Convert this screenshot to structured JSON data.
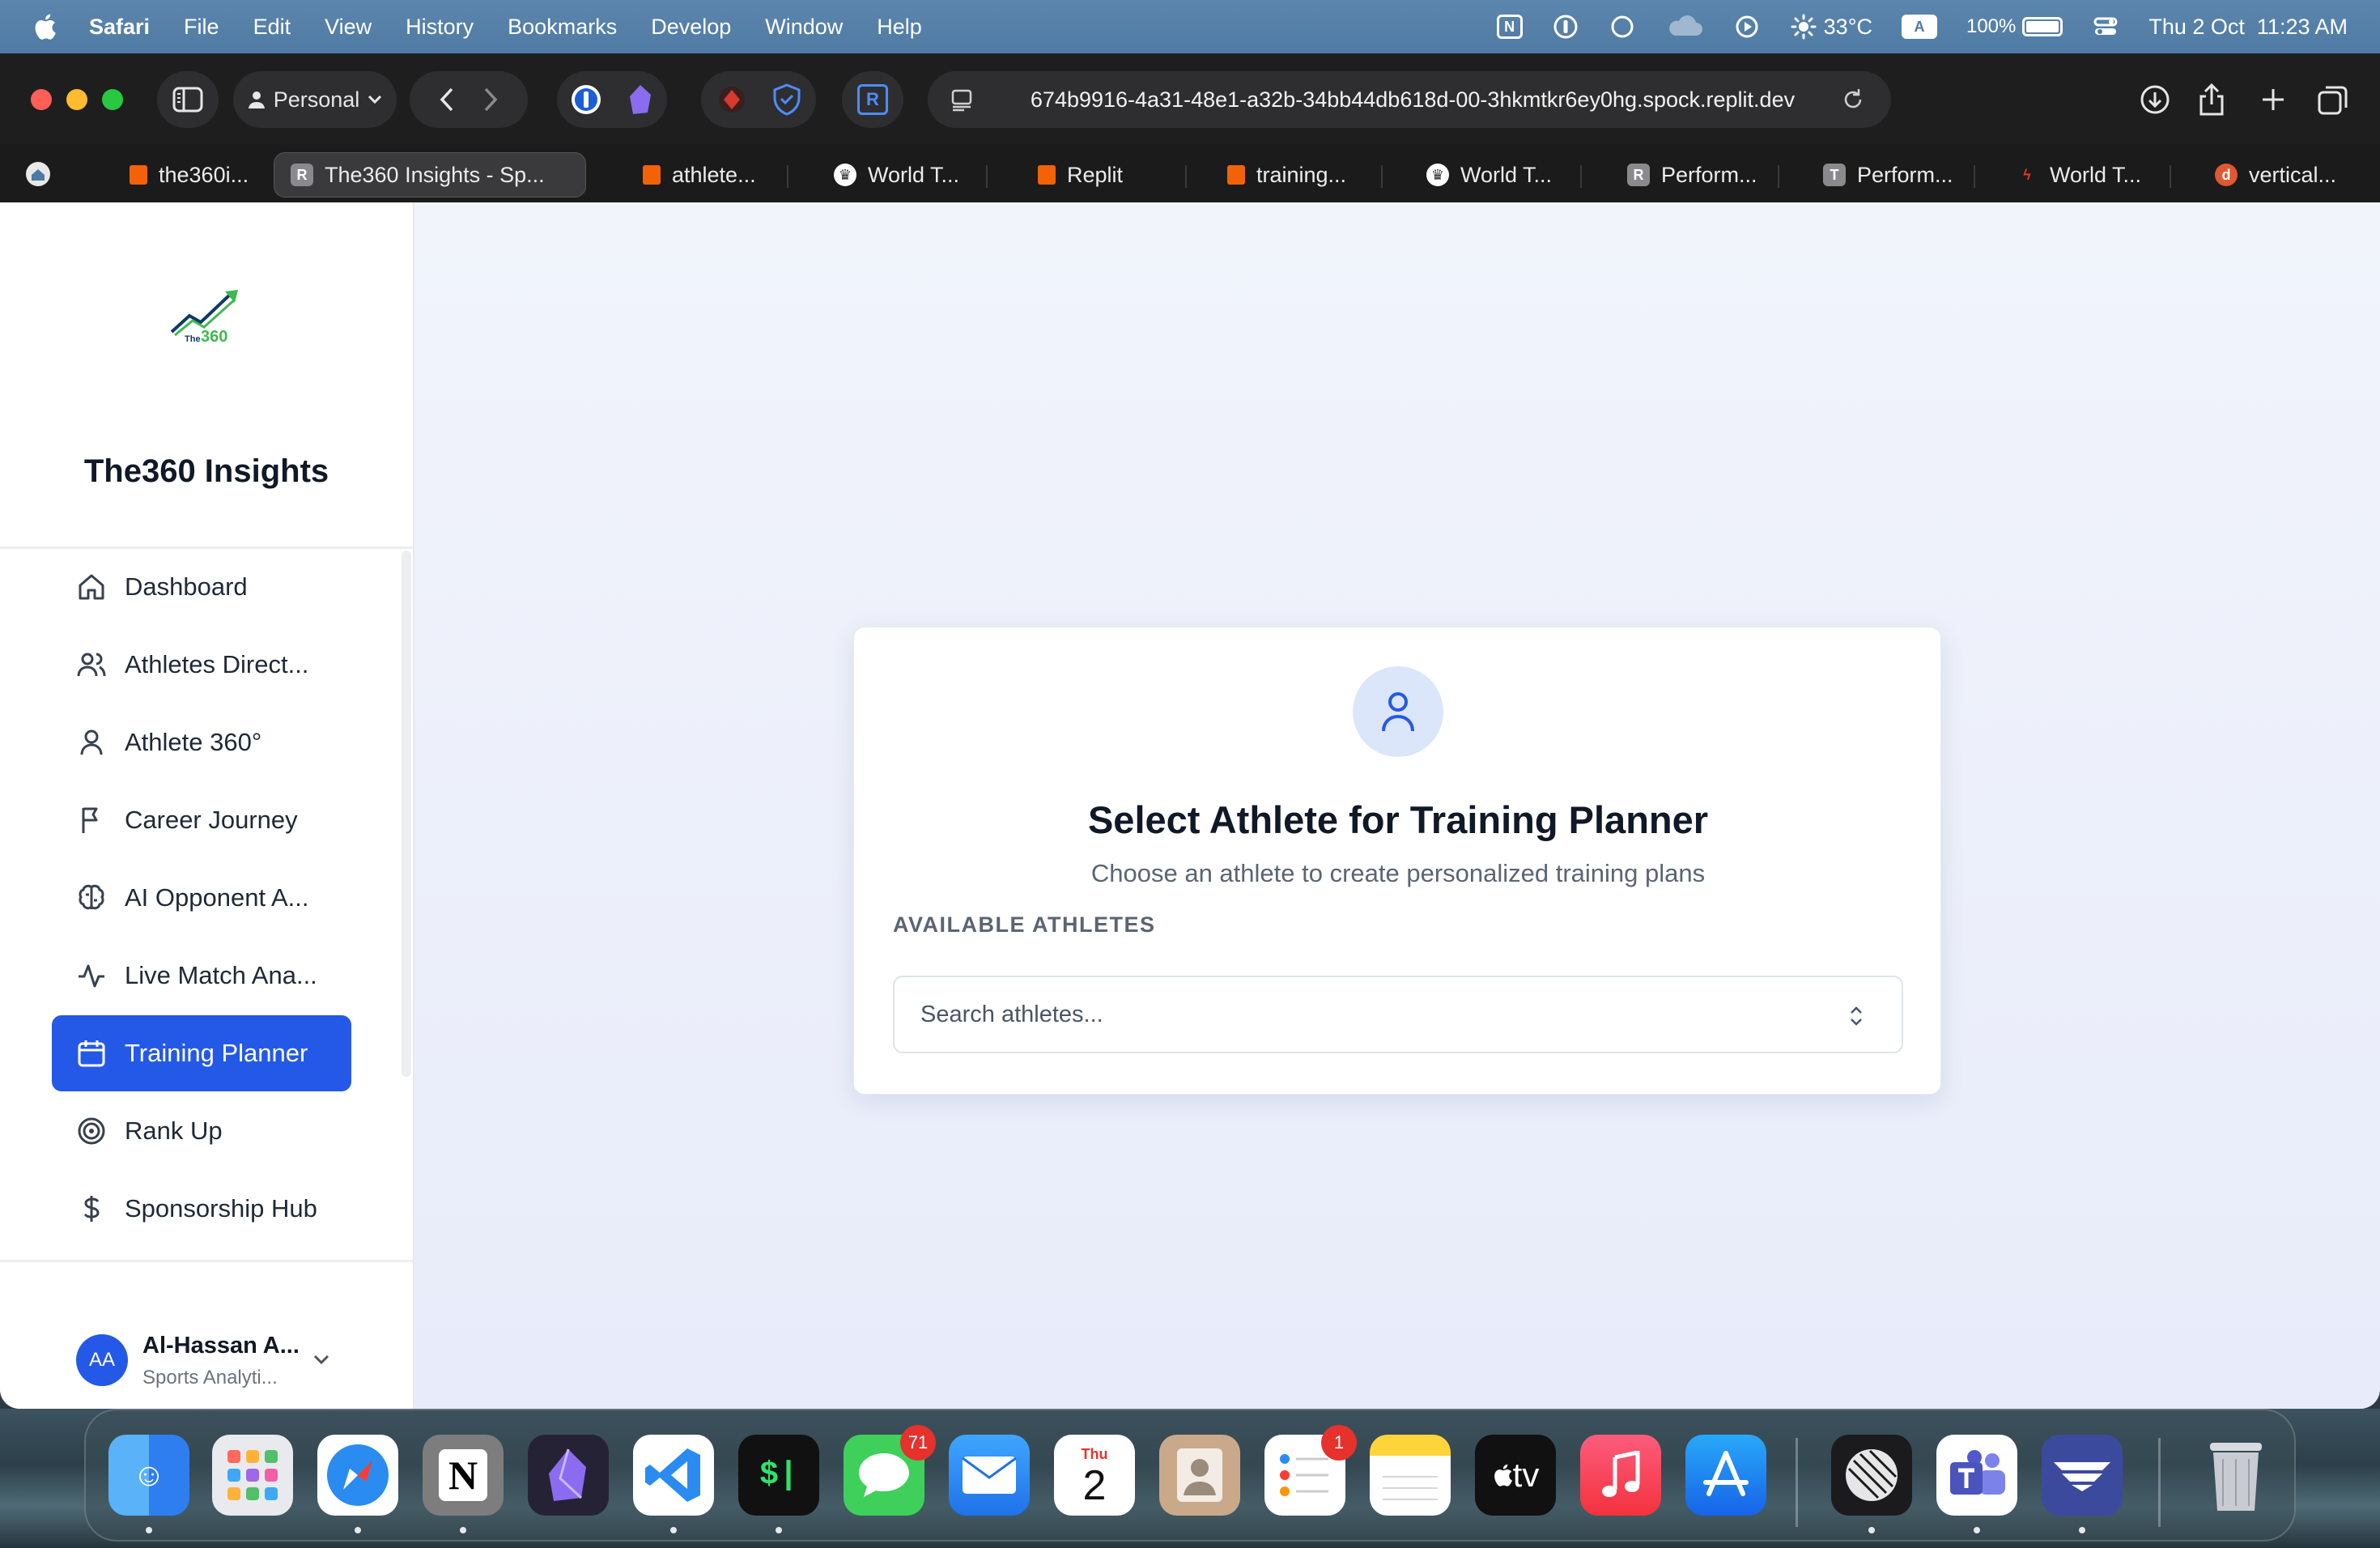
{
  "menubar": {
    "app": "Safari",
    "items": [
      "File",
      "Edit",
      "View",
      "History",
      "Bookmarks",
      "Develop",
      "Window",
      "Help"
    ],
    "weather": "33°C",
    "input_source": "A",
    "battery": "100%",
    "datetime": "Thu 2 Oct  11:23 AM"
  },
  "browser": {
    "profile": "Personal",
    "url": "674b9916-4a31-48e1-a32b-34bb44db618d-00-3hkmtkr6ey0hg.spock.replit.dev",
    "tabs": [
      {
        "label": "the360i...",
        "favicon": "replit-icon"
      },
      {
        "label": "The360 Insights - Sp...",
        "favicon": "r-icon",
        "active": true
      },
      {
        "label": "athlete...",
        "favicon": "replit-icon"
      },
      {
        "label": "World T...",
        "favicon": "crown-icon"
      },
      {
        "label": "Replit",
        "favicon": "replit-icon"
      },
      {
        "label": "training...",
        "favicon": "replit-icon"
      },
      {
        "label": "World T...",
        "favicon": "crown-icon"
      },
      {
        "label": "Perform...",
        "favicon": "r-icon"
      },
      {
        "label": "Perform...",
        "favicon": "t-icon"
      },
      {
        "label": "World T...",
        "favicon": "flame-icon"
      },
      {
        "label": "vertical...",
        "favicon": "duck-icon"
      }
    ]
  },
  "sidebar": {
    "brand": "The360 Insights",
    "logo_text": "The360",
    "items": [
      {
        "label": "Dashboard",
        "icon": "home-icon"
      },
      {
        "label": "Athletes Direct...",
        "icon": "users-icon"
      },
      {
        "label": "Athlete 360°",
        "icon": "user-icon"
      },
      {
        "label": "Career Journey",
        "icon": "flag-icon"
      },
      {
        "label": "AI Opponent A...",
        "icon": "brain-icon"
      },
      {
        "label": "Live Match Ana...",
        "icon": "activity-icon"
      },
      {
        "label": "Training Planner",
        "icon": "calendar-icon",
        "active": true
      },
      {
        "label": "Rank Up",
        "icon": "target-icon"
      },
      {
        "label": "Sponsorship Hub",
        "icon": "dollar-icon"
      }
    ],
    "user": {
      "initials": "AA",
      "name": "Al-Hassan A...",
      "role": "Sports Analyti..."
    }
  },
  "main": {
    "title": "Select Athlete for Training Planner",
    "subtitle": "Choose an athlete to create personalized training plans",
    "section_label": "AVAILABLE ATHLETES",
    "search_placeholder": "Search athletes..."
  },
  "dock": {
    "messages_badge": "71",
    "reminders_badge": "1",
    "calendar_day": "Thu",
    "calendar_date": "2",
    "tv_label": "tv"
  },
  "colors": {
    "accent": "#2459e8",
    "menubar": "#5c86ad"
  }
}
